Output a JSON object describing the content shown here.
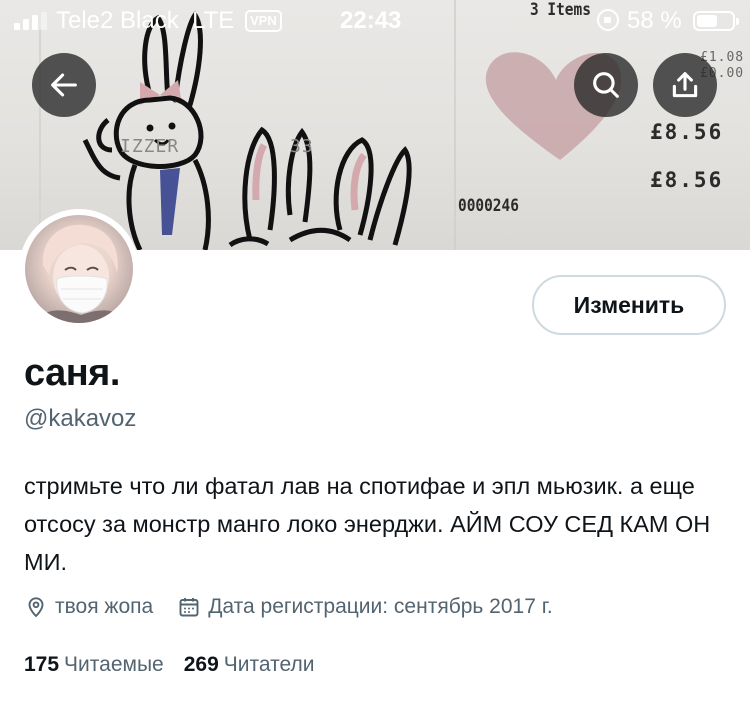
{
  "status_bar": {
    "carrier": "Tele2 Black",
    "network": "LTE",
    "vpn": "VPN",
    "time": "22:43",
    "battery_percent": "58 %",
    "battery_level": 0.58
  },
  "header": {
    "back_icon": "arrow-left-icon",
    "search_icon": "search-icon",
    "share_icon": "share-icon"
  },
  "banner": {
    "receipt_lines": [
      "3 Items",
      "£1.08",
      "£0.00",
      "£8.56",
      "£8.56",
      "0000246",
      "IZZER",
      "33"
    ],
    "heart_color": "#c8a7aa"
  },
  "profile": {
    "edit_label": "Изменить",
    "display_name": "саня.",
    "handle": "@kakavoz",
    "bio": "стримьте что ли фатал лав на спотифае и эпл мьюзик. а еще отсосу за монстр манго локо энерджи. АЙМ СОУ СЕД КАМ ОН МИ.",
    "location": "твоя жопа",
    "joined": "Дата регистрации: сентябрь 2017 г.",
    "following_count": "175",
    "following_label": "Читаемые",
    "followers_count": "269",
    "followers_label": "Читатели"
  },
  "colors": {
    "text_primary": "#0f1419",
    "text_secondary": "#536471",
    "button_border": "#cfd9de"
  }
}
